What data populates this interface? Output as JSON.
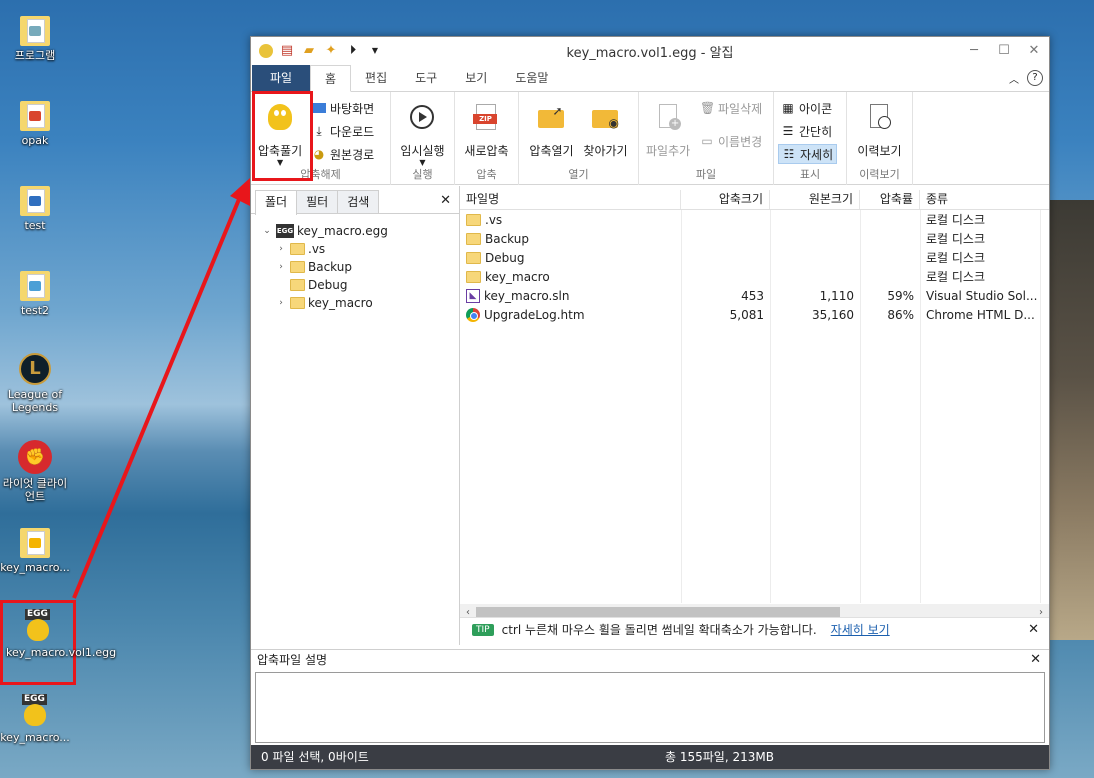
{
  "desktop": {
    "icons": [
      {
        "label": "프로그램"
      },
      {
        "label": "opak"
      },
      {
        "label": "test"
      },
      {
        "label": "test2"
      },
      {
        "label": "League of Legends"
      },
      {
        "label": "라이엇 클라이언트"
      },
      {
        "label": "key_macro..."
      },
      {
        "label": "key_macro.vol1.egg"
      },
      {
        "label": "key_macro..."
      }
    ],
    "egg_tag": "EGG"
  },
  "window": {
    "title": "key_macro.vol1.egg - 알집",
    "tabs": [
      "파일",
      "홈",
      "편집",
      "도구",
      "보기",
      "도움말"
    ],
    "help_label": "?"
  },
  "ribbon": {
    "extract": {
      "label": "압축풀기",
      "group": "압축해제"
    },
    "desktop": "바탕화면",
    "download": "다운로드",
    "original_path": "원본경로",
    "run_temp": {
      "label": "임시실행",
      "group": "실행"
    },
    "new_compress": {
      "label": "새로압축",
      "group": "압축"
    },
    "open_archive": "압축열기",
    "find": "찾아가기",
    "open_group": "열기",
    "add_file": "파일추가",
    "delete_file": "파일삭제",
    "rename": "이름변경",
    "file_group": "파일",
    "icons_view": "아이콘",
    "simple_view": "간단히",
    "detail_view": "자세히",
    "view_group": "표시",
    "history": {
      "label": "이력보기",
      "group": "이력보기"
    }
  },
  "left_pane": {
    "tabs": [
      "폴더",
      "필터",
      "검색"
    ],
    "tree_root": "key_macro.egg",
    "tree_children": [
      ".vs",
      "Backup",
      "Debug",
      "key_macro"
    ]
  },
  "list": {
    "headers": {
      "name": "파일명",
      "size": "압축크기",
      "orig": "원본크기",
      "rate": "압축률",
      "type": "종류"
    },
    "rows": [
      {
        "name": ".vs",
        "size": "",
        "orig": "",
        "rate": "",
        "type": "로컬 디스크",
        "icon": "folder"
      },
      {
        "name": "Backup",
        "size": "",
        "orig": "",
        "rate": "",
        "type": "로컬 디스크",
        "icon": "folder"
      },
      {
        "name": "Debug",
        "size": "",
        "orig": "",
        "rate": "",
        "type": "로컬 디스크",
        "icon": "folder"
      },
      {
        "name": "key_macro",
        "size": "",
        "orig": "",
        "rate": "",
        "type": "로컬 디스크",
        "icon": "folder"
      },
      {
        "name": "key_macro.sln",
        "size": "453",
        "orig": "1,110",
        "rate": "59%",
        "type": "Visual Studio Sol...",
        "icon": "sln"
      },
      {
        "name": "UpgradeLog.htm",
        "size": "5,081",
        "orig": "35,160",
        "rate": "86%",
        "type": "Chrome HTML D...",
        "icon": "chrome"
      }
    ]
  },
  "tip": {
    "badge": "TIP",
    "text": "ctrl 누른채 마우스 휠을 돌리면 썸네일 확대축소가 가능합니다.",
    "link": "자세히 보기"
  },
  "description": {
    "title": "압축파일 설명"
  },
  "status": {
    "left": "0 파일 선택,  0바이트",
    "right": "총 155파일,  213MB"
  },
  "colors": {
    "highlight": "#e8161b",
    "file_tab": "#2a4e7a",
    "status_bg": "#3a3d44"
  }
}
